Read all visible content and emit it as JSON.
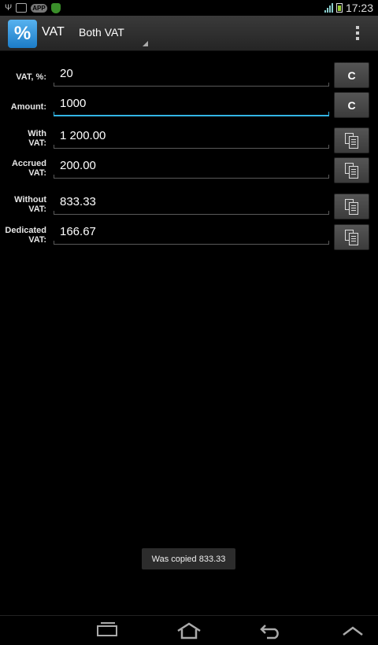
{
  "status_bar": {
    "time": "17:23",
    "left_icons": [
      "usb-icon",
      "image-icon",
      "app-badge-icon",
      "shield-icon"
    ],
    "badge_text": "APP",
    "right_icons": [
      "signal-icon",
      "battery-icon"
    ]
  },
  "action_bar": {
    "app_icon_glyph": "%",
    "title": "VAT",
    "mode": "Both VAT",
    "accent": "#33b5e5"
  },
  "rows": [
    {
      "label": "VAT, %:",
      "value": "20",
      "action": "C"
    },
    {
      "label": "Amount:",
      "value": "1000",
      "action": "C"
    },
    {
      "label": "With VAT:",
      "label_line1": "With",
      "label_line2": "VAT:",
      "value": "1 200.00",
      "action": "copy-icon"
    },
    {
      "label": "Accrued VAT:",
      "label_line1": "Accrued",
      "label_line2": "VAT:",
      "value": "200.00",
      "action": "copy-icon"
    },
    {
      "label": "Without VAT:",
      "label_line1": "Without",
      "label_line2": "VAT:",
      "value": "833.33",
      "action": "copy-icon"
    },
    {
      "label": "Dedicated VAT:",
      "label_line1": "Dedicated",
      "label_line2": "VAT:",
      "value": "166.67",
      "action": "copy-icon"
    }
  ],
  "toast": {
    "text": "Was copied 833.33"
  },
  "nav_bar": {
    "buttons": [
      "recents-icon",
      "home-icon",
      "back-icon",
      "up-chevron-icon"
    ]
  }
}
